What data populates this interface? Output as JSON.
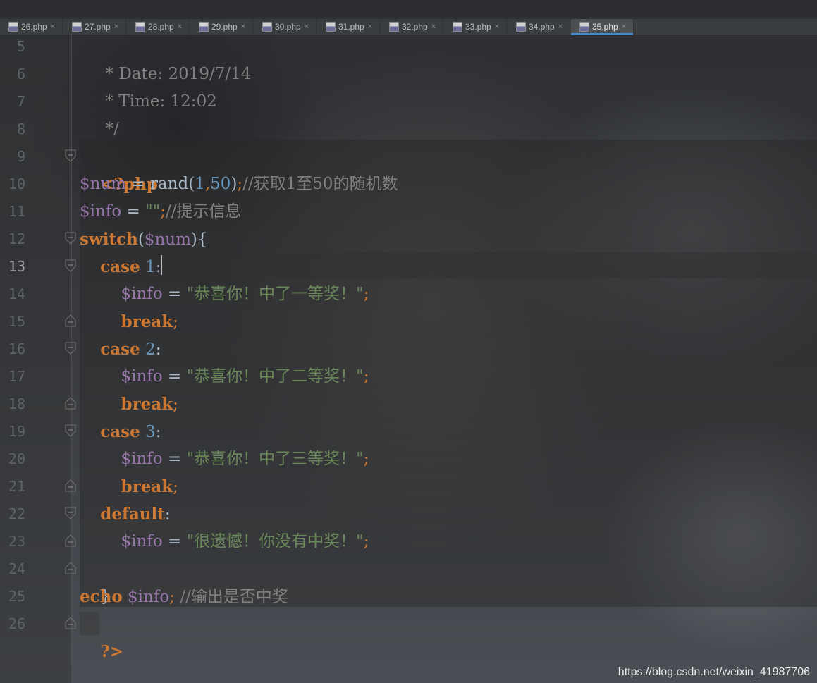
{
  "tabs": [
    {
      "label": "26.php"
    },
    {
      "label": "27.php"
    },
    {
      "label": "28.php"
    },
    {
      "label": "29.php"
    },
    {
      "label": "30.php"
    },
    {
      "label": "31.php"
    },
    {
      "label": "32.php"
    },
    {
      "label": "33.php"
    },
    {
      "label": "34.php"
    },
    {
      "label": "35.php"
    }
  ],
  "active_tab": "35.php",
  "tab_icon_text": "php",
  "tab_close_glyph": "×",
  "editor": {
    "line_numbers": [
      "5",
      "6",
      "7",
      "8",
      "9",
      "10",
      "11",
      "12",
      "13",
      "14",
      "15",
      "16",
      "17",
      "18",
      "19",
      "20",
      "21",
      "22",
      "23",
      "24",
      "25",
      "26"
    ],
    "current_line": "13",
    "lines": {
      "l5": " * Date: 2019/7/14",
      "l6": " * Time: 12:02",
      "l7": " */",
      "l9_open": "<?php",
      "l10_var": "$num",
      "l10_op": " = rand(",
      "l10_n1": "1",
      "l10_comma": ",",
      "l10_n2": "50",
      "l10_close": ")",
      "l10_semi": ";",
      "l10_comment": "//获取1至50的随机数",
      "l11_var": "$info",
      "l11_op": " = ",
      "l11_str": "\"\"",
      "l11_semi": ";",
      "l11_comment": "//提示信息",
      "l12_kw": "switch",
      "l12_paren": "(",
      "l12_var": "$num",
      "l12_rest": "){",
      "l13_kw": "case",
      "l13_num": "1",
      "l13_colon": ":",
      "l14_var": "$info",
      "l14_op": " = ",
      "l14_str": "\"恭喜你！中了一等奖！\"",
      "l14_semi": ";",
      "l15_kw": "break",
      "l15_semi": ";",
      "l16_kw": "case",
      "l16_num": "2",
      "l16_colon": ":",
      "l17_var": "$info",
      "l17_op": " = ",
      "l17_str": "\"恭喜你！中了二等奖！\"",
      "l17_semi": ";",
      "l18_kw": "break",
      "l18_semi": ";",
      "l19_kw": "case",
      "l19_num": "3",
      "l19_colon": ":",
      "l20_var": "$info",
      "l20_op": " = ",
      "l20_str": "\"恭喜你！中了三等奖！\"",
      "l20_semi": ";",
      "l21_kw": "break",
      "l21_semi": ";",
      "l22_kw": "default",
      "l22_colon": ":",
      "l23_var": "$info",
      "l23_op": " = ",
      "l23_str": "\"很遗憾！你没有中奖！\"",
      "l23_semi": ";",
      "l24": "}",
      "l25_kw": "echo",
      "l25_var": " $info",
      "l25_semi": ";",
      "l25_comment": " //输出是否中奖",
      "l26_close": "?>"
    }
  },
  "watermark": "https://blog.csdn.net/weixin_41987706",
  "colors": {
    "keyword": "#cc7832",
    "variable": "#9876aa",
    "number": "#6897bb",
    "string": "#6a8759",
    "comment": "#808080",
    "default_text": "#a9b7c6",
    "active_tab_underline": "#4a88c7"
  }
}
